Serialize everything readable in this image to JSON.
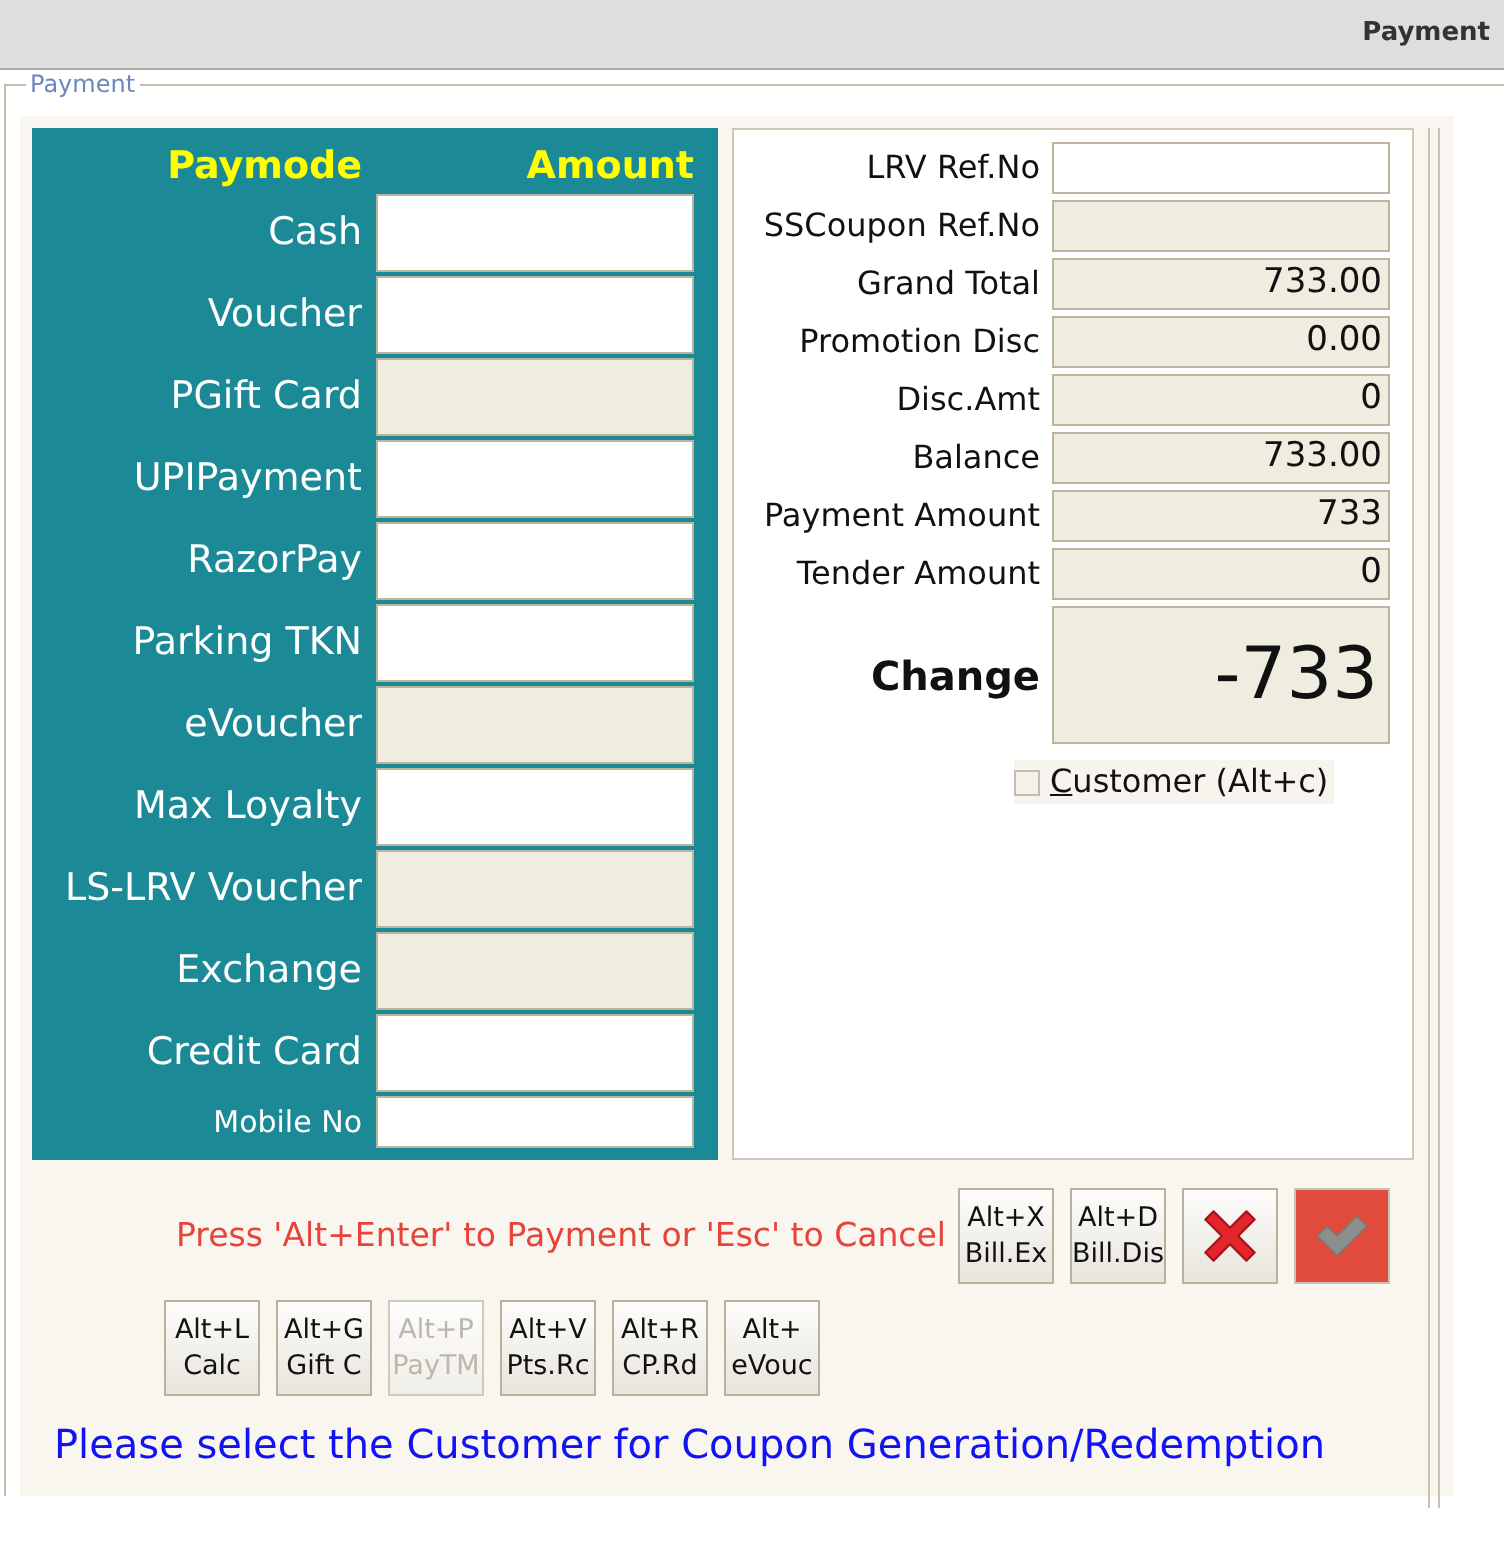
{
  "window": {
    "title": "Payment"
  },
  "group": {
    "legend": "Payment"
  },
  "paymodes": {
    "columns": [
      "Paymode",
      "Amount"
    ],
    "rows": [
      {
        "kind": "amount",
        "label": "Cash",
        "disabled": false
      },
      {
        "kind": "amount",
        "label": "Voucher",
        "disabled": false
      },
      {
        "kind": "amount",
        "label": "PGift Card",
        "disabled": true
      },
      {
        "kind": "amount",
        "label": "UPIPayment",
        "disabled": false
      },
      {
        "kind": "amount",
        "label": "RazorPay",
        "disabled": false
      },
      {
        "kind": "amount",
        "label": "Parking TKN",
        "disabled": false
      },
      {
        "kind": "amount",
        "label": "eVoucher",
        "disabled": true
      },
      {
        "kind": "amount",
        "label": "Max Loyalty",
        "disabled": false
      },
      {
        "kind": "amount",
        "label": "LS-LRV Voucher",
        "disabled": true
      },
      {
        "kind": "amount",
        "label": "Exchange",
        "disabled": true
      },
      {
        "kind": "amount",
        "label": "Credit Card",
        "disabled": false
      },
      {
        "kind": "mobile",
        "label": "Mobile No",
        "disabled": false
      }
    ]
  },
  "summary": {
    "fields": [
      {
        "label": "LRV Ref.No",
        "disabled": false
      },
      {
        "label": "SSCoupon Ref.No",
        "disabled": true
      },
      {
        "label": "Grand Total",
        "value": "733.00",
        "disabled": true
      },
      {
        "label": "Promotion Disc",
        "value": "0.00",
        "disabled": true
      },
      {
        "label": "Disc.Amt",
        "value": "0",
        "disabled": true
      },
      {
        "label": "Balance",
        "value": "733.00",
        "disabled": true
      },
      {
        "label": "Payment Amount",
        "value": "733",
        "disabled": true
      },
      {
        "label": "Tender Amount",
        "value": "0",
        "disabled": true
      }
    ],
    "change": {
      "label": "Change",
      "value": "-733"
    },
    "customer_option": {
      "label": "Customer (Alt+c)",
      "checked": false
    }
  },
  "hint": "Press 'Alt+Enter' to Payment or 'Esc' to Cancel",
  "shortcut_buttons": [
    {
      "key": "Alt+X",
      "caption": "Bill.Ex",
      "disabled": false
    },
    {
      "key": "Alt+D",
      "caption": "Bill.Dis",
      "disabled": false
    }
  ],
  "action_buttons": [
    {
      "kind": "cancel"
    },
    {
      "kind": "confirm"
    }
  ],
  "extra_buttons": [
    {
      "key": "Alt+L",
      "caption": "Calc",
      "disabled": false
    },
    {
      "key": "Alt+G",
      "caption": "Gift C",
      "disabled": false
    },
    {
      "key": "Alt+P",
      "caption": "PayTM",
      "disabled": true
    },
    {
      "key": "Alt+V",
      "caption": "Pts.Rc",
      "disabled": false
    },
    {
      "key": "Alt+R",
      "caption": "CP.Rd",
      "disabled": false
    },
    {
      "key": "Alt+",
      "caption": "eVouc",
      "disabled": false
    }
  ],
  "message": "Please select the Customer for Coupon Generation/Redemption"
}
